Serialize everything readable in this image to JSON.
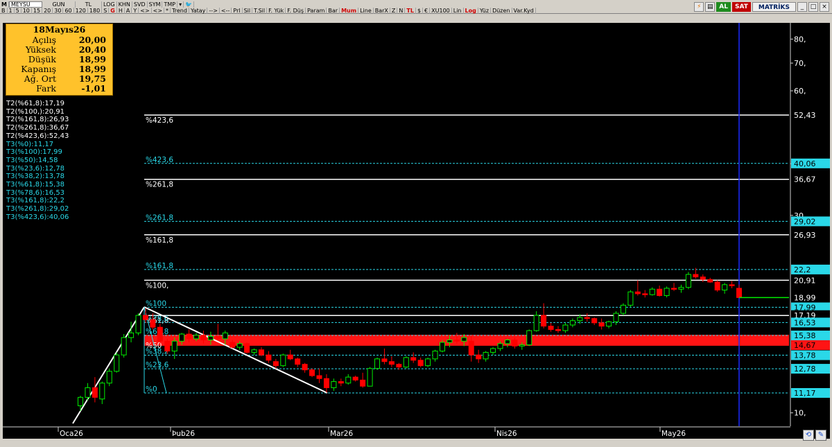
{
  "toolbar": {
    "m_label": "M",
    "symbol": "MEYSU",
    "period_label": "GUN",
    "currency_label": "TL",
    "log_label": "LOG",
    "khn_label": "KHN",
    "svd_label": "SVD",
    "sym_label": "SYM",
    "tmp_label": "TMP",
    "row2": [
      "B",
      "1",
      "5",
      "10",
      "15",
      "20",
      "30",
      "60",
      "120",
      "180",
      "S",
      "G",
      "H",
      "A",
      "Y",
      "<>",
      "<>",
      "*",
      "Trend",
      "Yatay",
      "-->",
      "<--",
      "Prl",
      "Sil",
      "T.Sil",
      "F. Yük",
      "F. Düş",
      "Param",
      "Bar",
      "Mum",
      "Line",
      "BarX",
      "Z",
      "N",
      "TL",
      "$",
      "€",
      "XU100",
      "Lin",
      "Log",
      "Yüz",
      "Düzen",
      "Var.Kyd"
    ],
    "al_label": "AL",
    "sat_label": "SAT",
    "matriks_label": "MATRİKS"
  },
  "info": {
    "date": "18Mayıs26",
    "rows": [
      {
        "label": "Açılış",
        "value": "20,00"
      },
      {
        "label": "Yüksek",
        "value": "20,40"
      },
      {
        "label": "Düşük",
        "value": "18,99"
      },
      {
        "label": "Kapanış",
        "value": "18,99"
      },
      {
        "label": "Ağ. Ort",
        "value": "19,75"
      },
      {
        "label": "Fark",
        "value": "-1,01"
      }
    ]
  },
  "fib_list": [
    {
      "text": "T2(%61,8):17,19",
      "color": "#ffffff"
    },
    {
      "text": "T2(%100,):20,91",
      "color": "#ffffff"
    },
    {
      "text": "T2(%161,8):26,93",
      "color": "#ffffff"
    },
    {
      "text": "T2(%261,8):36,67",
      "color": "#ffffff"
    },
    {
      "text": "T2(%423,6):52,43",
      "color": "#ffffff"
    },
    {
      "text": "T3(%0):11,17",
      "color": "#2ad8e8"
    },
    {
      "text": "T3(%100):17,99",
      "color": "#2ad8e8"
    },
    {
      "text": "T3(%50):14,58",
      "color": "#2ad8e8"
    },
    {
      "text": "T3(%23,6):12,78",
      "color": "#2ad8e8"
    },
    {
      "text": "T3(%38,2):13,78",
      "color": "#2ad8e8"
    },
    {
      "text": "T3(%61,8):15,38",
      "color": "#2ad8e8"
    },
    {
      "text": "T3(%78,6):16,53",
      "color": "#2ad8e8"
    },
    {
      "text": "T3(%161,8):22,2",
      "color": "#2ad8e8"
    },
    {
      "text": "T3(%261,8):29,02",
      "color": "#2ad8e8"
    },
    {
      "text": "T3(%423,6):40,06",
      "color": "#2ad8e8"
    }
  ],
  "chart_data": {
    "type": "candlestick",
    "symbol": "MEYSU",
    "y_scale": "log",
    "ylim": [
      9.5,
      90
    ],
    "y_ticks": [
      {
        "value": 80,
        "label": "80,"
      },
      {
        "value": 70,
        "label": "70,"
      },
      {
        "value": 60,
        "label": "60,"
      },
      {
        "value": 40,
        "label": "40,"
      },
      {
        "value": 30,
        "label": "30,"
      },
      {
        "value": 10,
        "label": "10,"
      }
    ],
    "x_labels": [
      "Oca26",
      "Þub26",
      "Mar26",
      "Nis26",
      "May26"
    ],
    "fib_levels": [
      {
        "label": "%423,6",
        "value": 52.43,
        "tag": "52,43",
        "style": "white"
      },
      {
        "label": "%423,6",
        "value": 40.06,
        "tag": "40,06",
        "style": "cyan"
      },
      {
        "label": "%261,8",
        "value": 36.67,
        "tag": "36,67",
        "style": "white"
      },
      {
        "label": "%261,8",
        "value": 29.02,
        "tag": "29,02",
        "style": "cyan"
      },
      {
        "label": "%161,8",
        "value": 26.93,
        "tag": "26,93",
        "style": "white"
      },
      {
        "label": "%161,8",
        "value": 22.2,
        "tag": "22,2",
        "style": "cyan"
      },
      {
        "label": "%100,",
        "value": 20.91,
        "tag": "20,91",
        "style": "white"
      },
      {
        "label": "%100",
        "value": 17.99,
        "tag": "17,99",
        "style": "cyan"
      },
      {
        "label": "%61,8",
        "value": 17.19,
        "tag": "17,19",
        "style": "white"
      },
      {
        "label": "%78,6",
        "value": 16.53,
        "tag": "16,53",
        "style": "cyan"
      },
      {
        "label": "%61,8",
        "value": 15.38,
        "tag": "15,38",
        "style": "cyan"
      },
      {
        "label": "%50",
        "value": 14.58,
        "tag": "14,67",
        "style": "red"
      },
      {
        "label": "%38,2",
        "value": 13.78,
        "tag": "13,78",
        "style": "cyan"
      },
      {
        "label": "%23,6",
        "value": 12.78,
        "tag": "12,78",
        "style": "cyan"
      },
      {
        "label": "%0",
        "value": 11.17,
        "tag": "11,17",
        "style": "cyan"
      }
    ],
    "last_price": {
      "value": 18.99,
      "tag": "18,99"
    },
    "candles": [
      {
        "o": 10.4,
        "h": 11.0,
        "l": 10.1,
        "c": 10.9
      },
      {
        "o": 10.9,
        "h": 11.8,
        "l": 10.7,
        "c": 11.5
      },
      {
        "o": 11.5,
        "h": 12.2,
        "l": 10.6,
        "c": 10.9
      },
      {
        "o": 10.8,
        "h": 11.9,
        "l": 10.5,
        "c": 11.8
      },
      {
        "o": 11.8,
        "h": 12.8,
        "l": 11.6,
        "c": 12.6
      },
      {
        "o": 12.6,
        "h": 14.0,
        "l": 12.5,
        "c": 13.8
      },
      {
        "o": 13.8,
        "h": 15.5,
        "l": 13.6,
        "c": 15.2
      },
      {
        "o": 15.2,
        "h": 16.6,
        "l": 14.8,
        "c": 15.6
      },
      {
        "o": 15.6,
        "h": 17.4,
        "l": 15.4,
        "c": 17.2
      },
      {
        "o": 17.2,
        "h": 17.9,
        "l": 16.5,
        "c": 16.8
      },
      {
        "o": 16.8,
        "h": 17.4,
        "l": 15.9,
        "c": 16.1
      },
      {
        "o": 16.1,
        "h": 16.4,
        "l": 14.6,
        "c": 14.9
      },
      {
        "o": 14.9,
        "h": 15.1,
        "l": 13.9,
        "c": 14.1
      },
      {
        "o": 14.1,
        "h": 15.2,
        "l": 13.5,
        "c": 14.9
      },
      {
        "o": 14.9,
        "h": 15.6,
        "l": 14.6,
        "c": 15.5
      },
      {
        "o": 15.5,
        "h": 15.9,
        "l": 14.8,
        "c": 15.1
      },
      {
        "o": 15.1,
        "h": 15.6,
        "l": 14.9,
        "c": 15.4
      },
      {
        "o": 15.4,
        "h": 15.8,
        "l": 14.7,
        "c": 15.0
      },
      {
        "o": 15.0,
        "h": 15.7,
        "l": 14.6,
        "c": 15.3
      },
      {
        "o": 15.3,
        "h": 16.4,
        "l": 15.0,
        "c": 15.1
      },
      {
        "o": 15.1,
        "h": 15.8,
        "l": 14.6,
        "c": 15.6
      },
      {
        "o": 14.8,
        "h": 15.0,
        "l": 14.3,
        "c": 14.4
      },
      {
        "o": 14.4,
        "h": 14.9,
        "l": 14.2,
        "c": 14.7
      },
      {
        "o": 14.7,
        "h": 14.8,
        "l": 13.9,
        "c": 14.0
      },
      {
        "o": 14.0,
        "h": 14.3,
        "l": 13.8,
        "c": 14.2
      },
      {
        "o": 14.2,
        "h": 14.4,
        "l": 13.7,
        "c": 13.8
      },
      {
        "o": 13.8,
        "h": 14.1,
        "l": 13.2,
        "c": 13.4
      },
      {
        "o": 13.3,
        "h": 13.5,
        "l": 12.8,
        "c": 13.0
      },
      {
        "o": 13.0,
        "h": 13.9,
        "l": 12.9,
        "c": 13.8
      },
      {
        "o": 13.8,
        "h": 14.2,
        "l": 13.4,
        "c": 13.5
      },
      {
        "o": 13.5,
        "h": 13.6,
        "l": 12.9,
        "c": 13.1
      },
      {
        "o": 13.1,
        "h": 13.2,
        "l": 12.5,
        "c": 12.7
      },
      {
        "o": 12.7,
        "h": 12.8,
        "l": 12.2,
        "c": 12.3
      },
      {
        "o": 12.3,
        "h": 12.8,
        "l": 11.8,
        "c": 12.1
      },
      {
        "o": 12.1,
        "h": 12.4,
        "l": 11.2,
        "c": 11.5
      },
      {
        "o": 11.5,
        "h": 12.1,
        "l": 11.3,
        "c": 11.9
      },
      {
        "o": 11.9,
        "h": 12.1,
        "l": 11.6,
        "c": 11.8
      },
      {
        "o": 11.8,
        "h": 12.4,
        "l": 11.7,
        "c": 12.2
      },
      {
        "o": 12.2,
        "h": 12.3,
        "l": 11.9,
        "c": 12.0
      },
      {
        "o": 12.0,
        "h": 12.5,
        "l": 11.5,
        "c": 11.6
      },
      {
        "o": 11.6,
        "h": 12.9,
        "l": 11.6,
        "c": 12.8
      },
      {
        "o": 12.8,
        "h": 13.6,
        "l": 12.7,
        "c": 13.5
      },
      {
        "o": 13.5,
        "h": 14.3,
        "l": 13.1,
        "c": 13.3
      },
      {
        "o": 13.3,
        "h": 13.7,
        "l": 12.9,
        "c": 13.1
      },
      {
        "o": 13.1,
        "h": 13.2,
        "l": 12.7,
        "c": 12.9
      },
      {
        "o": 12.9,
        "h": 13.7,
        "l": 12.8,
        "c": 13.6
      },
      {
        "o": 13.6,
        "h": 14.0,
        "l": 13.2,
        "c": 13.4
      },
      {
        "o": 13.4,
        "h": 13.6,
        "l": 12.9,
        "c": 13.0
      },
      {
        "o": 13.0,
        "h": 13.6,
        "l": 12.9,
        "c": 13.5
      },
      {
        "o": 13.5,
        "h": 14.2,
        "l": 13.3,
        "c": 14.1
      },
      {
        "o": 14.1,
        "h": 15.0,
        "l": 14.0,
        "c": 14.8
      },
      {
        "o": 14.8,
        "h": 15.4,
        "l": 14.4,
        "c": 15.0
      },
      {
        "o": 15.0,
        "h": 15.6,
        "l": 14.7,
        "c": 14.9
      },
      {
        "o": 14.9,
        "h": 15.5,
        "l": 14.5,
        "c": 15.2
      },
      {
        "o": 14.9,
        "h": 15.4,
        "l": 13.3,
        "c": 13.8
      },
      {
        "o": 13.8,
        "h": 14.2,
        "l": 13.2,
        "c": 13.5
      },
      {
        "o": 13.5,
        "h": 14.1,
        "l": 13.3,
        "c": 14.0
      },
      {
        "o": 14.0,
        "h": 14.4,
        "l": 13.8,
        "c": 14.3
      },
      {
        "o": 14.3,
        "h": 14.9,
        "l": 14.1,
        "c": 14.7
      },
      {
        "o": 14.7,
        "h": 15.1,
        "l": 14.4,
        "c": 15.0
      },
      {
        "o": 15.0,
        "h": 15.2,
        "l": 14.3,
        "c": 14.5
      },
      {
        "o": 14.5,
        "h": 14.8,
        "l": 14.2,
        "c": 14.6
      },
      {
        "o": 14.6,
        "h": 15.9,
        "l": 14.5,
        "c": 15.8
      },
      {
        "o": 15.8,
        "h": 17.6,
        "l": 15.7,
        "c": 17.2
      },
      {
        "o": 17.2,
        "h": 18.4,
        "l": 16.0,
        "c": 16.2
      },
      {
        "o": 16.2,
        "h": 16.5,
        "l": 15.7,
        "c": 15.9
      },
      {
        "o": 15.9,
        "h": 16.2,
        "l": 15.6,
        "c": 15.8
      },
      {
        "o": 15.8,
        "h": 16.5,
        "l": 15.6,
        "c": 16.3
      },
      {
        "o": 16.3,
        "h": 16.9,
        "l": 16.1,
        "c": 16.7
      },
      {
        "o": 16.7,
        "h": 17.3,
        "l": 16.4,
        "c": 17.0
      },
      {
        "o": 17.0,
        "h": 17.4,
        "l": 16.6,
        "c": 16.9
      },
      {
        "o": 16.9,
        "h": 17.0,
        "l": 16.3,
        "c": 16.5
      },
      {
        "o": 16.5,
        "h": 16.9,
        "l": 15.9,
        "c": 16.2
      },
      {
        "o": 16.2,
        "h": 16.7,
        "l": 16.0,
        "c": 16.6
      },
      {
        "o": 16.6,
        "h": 17.6,
        "l": 16.3,
        "c": 17.4
      },
      {
        "o": 17.4,
        "h": 18.4,
        "l": 17.2,
        "c": 18.2
      },
      {
        "o": 18.2,
        "h": 19.8,
        "l": 18.0,
        "c": 19.6
      },
      {
        "o": 19.6,
        "h": 20.9,
        "l": 19.2,
        "c": 19.4
      },
      {
        "o": 19.4,
        "h": 19.8,
        "l": 19.0,
        "c": 19.3
      },
      {
        "o": 19.3,
        "h": 20.1,
        "l": 19.2,
        "c": 19.9
      },
      {
        "o": 19.9,
        "h": 20.3,
        "l": 19.1,
        "c": 19.2
      },
      {
        "o": 19.2,
        "h": 20.2,
        "l": 19.0,
        "c": 20.0
      },
      {
        "o": 20.0,
        "h": 20.6,
        "l": 19.7,
        "c": 19.9
      },
      {
        "o": 19.9,
        "h": 20.4,
        "l": 19.5,
        "c": 20.1
      },
      {
        "o": 20.1,
        "h": 21.9,
        "l": 19.9,
        "c": 21.6
      },
      {
        "o": 21.6,
        "h": 22.4,
        "l": 21.1,
        "c": 21.3
      },
      {
        "o": 21.3,
        "h": 21.6,
        "l": 20.7,
        "c": 21.0
      },
      {
        "o": 21.0,
        "h": 21.2,
        "l": 20.6,
        "c": 20.7
      },
      {
        "o": 20.7,
        "h": 20.9,
        "l": 19.6,
        "c": 19.8
      },
      {
        "o": 19.8,
        "h": 20.6,
        "l": 19.4,
        "c": 20.4
      },
      {
        "o": 20.4,
        "h": 20.8,
        "l": 20.0,
        "c": 20.3
      },
      {
        "o": 20.0,
        "h": 20.4,
        "l": 18.99,
        "c": 18.99
      }
    ]
  },
  "colors": {
    "background": "#000000",
    "up": "#00ee00",
    "down": "#ff0000",
    "fib_white": "#ffffff",
    "fib_cyan": "#2ad8e8",
    "fib_zone": "#ff1414",
    "today_line": "#1a2aff",
    "info_bg": "#ffc22b"
  }
}
